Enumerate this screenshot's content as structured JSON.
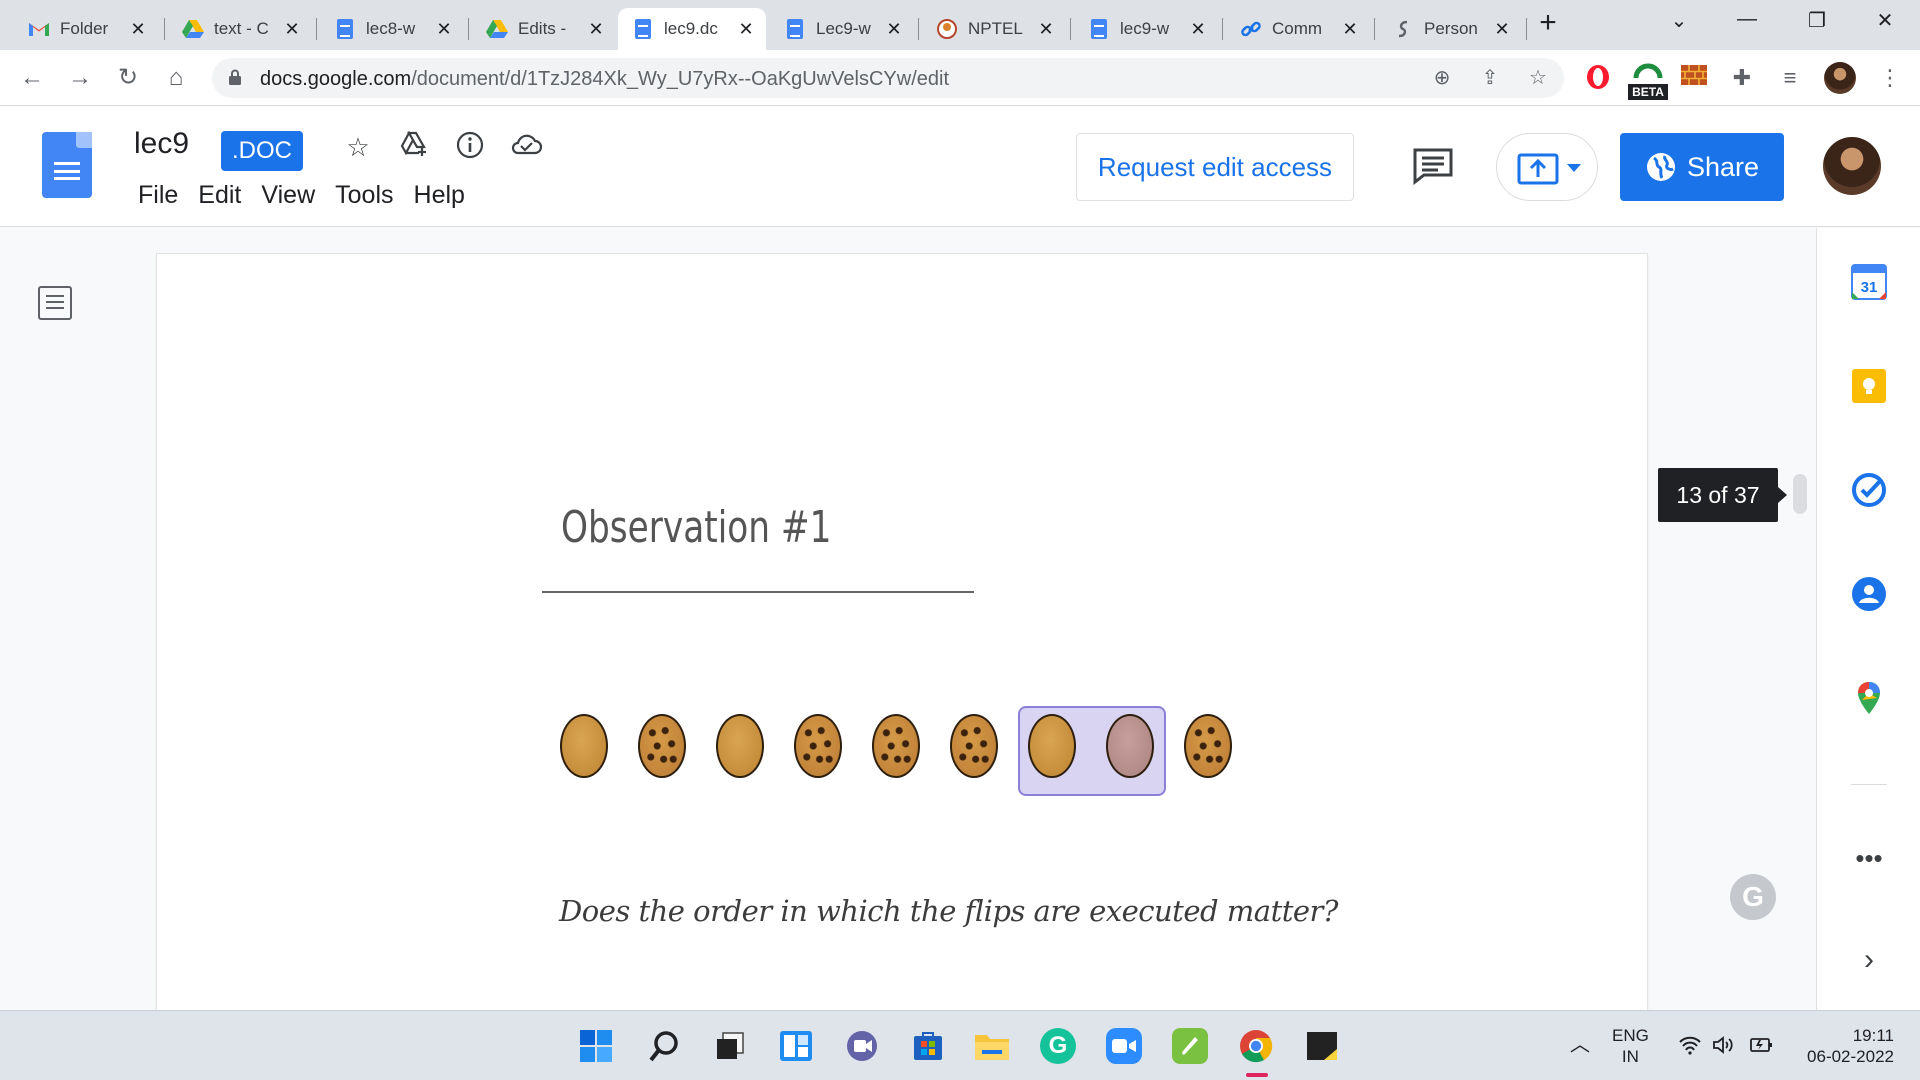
{
  "browser": {
    "tabs": [
      {
        "title": "Folder",
        "icon": "gmail-icon"
      },
      {
        "title": "text - C",
        "icon": "drive-icon"
      },
      {
        "title": "lec8-w",
        "icon": "docs-icon"
      },
      {
        "title": "Edits -",
        "icon": "drive-icon"
      },
      {
        "title": "lec9.dc",
        "icon": "docs-icon",
        "active": true
      },
      {
        "title": "Lec9-w",
        "icon": "docs-icon"
      },
      {
        "title": "NPTEL",
        "icon": "nptel-icon"
      },
      {
        "title": "lec9-w",
        "icon": "docs-icon"
      },
      {
        "title": "Comm",
        "icon": "link-icon"
      },
      {
        "title": "Person",
        "icon": "person-link-icon"
      }
    ],
    "url_domain": "docs.google.com",
    "url_path": "/document/d/1TzJ284Xk_Wy_U7yRx--OaKgUwVelsCYw/edit",
    "extension_beta_label": "BETA"
  },
  "doc": {
    "title": "lec9",
    "format_badge": ".DOC",
    "menu": [
      "File",
      "Edit",
      "View",
      "Tools",
      "Help"
    ],
    "request_edit_label": "Request edit access",
    "share_label": "Share",
    "page_indicator": "13 of 37"
  },
  "slide": {
    "title": "Observation #1",
    "coins": [
      "plain",
      "cookie",
      "plain",
      "cookie",
      "cookie",
      "cookie",
      "plain",
      "pink",
      "cookie"
    ],
    "highlighted_pair": [
      6,
      7
    ],
    "question": "Does the order in which the flips are executed matter?"
  },
  "sidepanel": {
    "calendar_day": "31"
  },
  "taskbar": {
    "lang_line1": "ENG",
    "lang_line2": "IN",
    "time": "19:11",
    "date": "06-02-2022"
  },
  "colors": {
    "accent": "#1a73e8",
    "docs_blue": "#4285f4",
    "highlight_fill": "#d8d4f2",
    "highlight_border": "#8a80d8"
  }
}
